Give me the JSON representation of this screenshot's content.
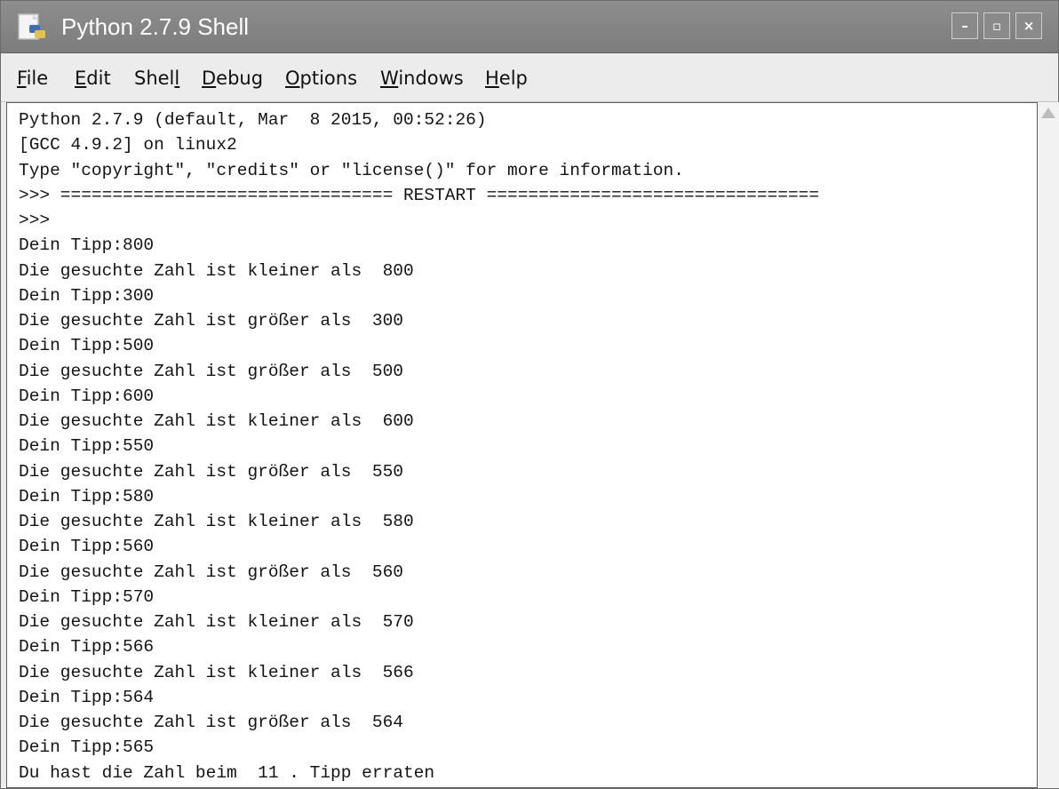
{
  "window": {
    "title": "Python 2.7.9 Shell",
    "controls": {
      "minimize": "–",
      "maximize": "▫",
      "close": "×"
    }
  },
  "menu": [
    {
      "label": "File",
      "mnemonic_index": 0
    },
    {
      "label": "Edit",
      "mnemonic_index": 0
    },
    {
      "label": "Shell",
      "mnemonic_index": 4
    },
    {
      "label": "Debug",
      "mnemonic_index": 0
    },
    {
      "label": "Options",
      "mnemonic_index": 0
    },
    {
      "label": "Windows",
      "mnemonic_index": 0
    },
    {
      "label": "Help",
      "mnemonic_index": 0
    }
  ],
  "shell": {
    "lines": [
      "Python 2.7.9 (default, Mar  8 2015, 00:52:26)",
      "[GCC 4.9.2] on linux2",
      "Type \"copyright\", \"credits\" or \"license()\" for more information.",
      ">>> ================================ RESTART ================================",
      ">>>",
      "Dein Tipp:800",
      "Die gesuchte Zahl ist kleiner als  800",
      "Dein Tipp:300",
      "Die gesuchte Zahl ist größer als  300",
      "Dein Tipp:500",
      "Die gesuchte Zahl ist größer als  500",
      "Dein Tipp:600",
      "Die gesuchte Zahl ist kleiner als  600",
      "Dein Tipp:550",
      "Die gesuchte Zahl ist größer als  550",
      "Dein Tipp:580",
      "Die gesuchte Zahl ist kleiner als  580",
      "Dein Tipp:560",
      "Die gesuchte Zahl ist größer als  560",
      "Dein Tipp:570",
      "Die gesuchte Zahl ist kleiner als  570",
      "Dein Tipp:566",
      "Die gesuchte Zahl ist kleiner als  566",
      "Dein Tipp:564",
      "Die gesuchte Zahl ist größer als  564",
      "Dein Tipp:565",
      "Du hast die Zahl beim  11 . Tipp erraten"
    ],
    "prompt": ">>>"
  },
  "icons": {
    "app": "python-shell-icon",
    "scroll_up": "scroll-up-arrow-icon"
  },
  "colors": {
    "titlebar": "#848484",
    "menubar": "#ececec",
    "editor_bg": "#ffffff",
    "text": "#141414"
  }
}
